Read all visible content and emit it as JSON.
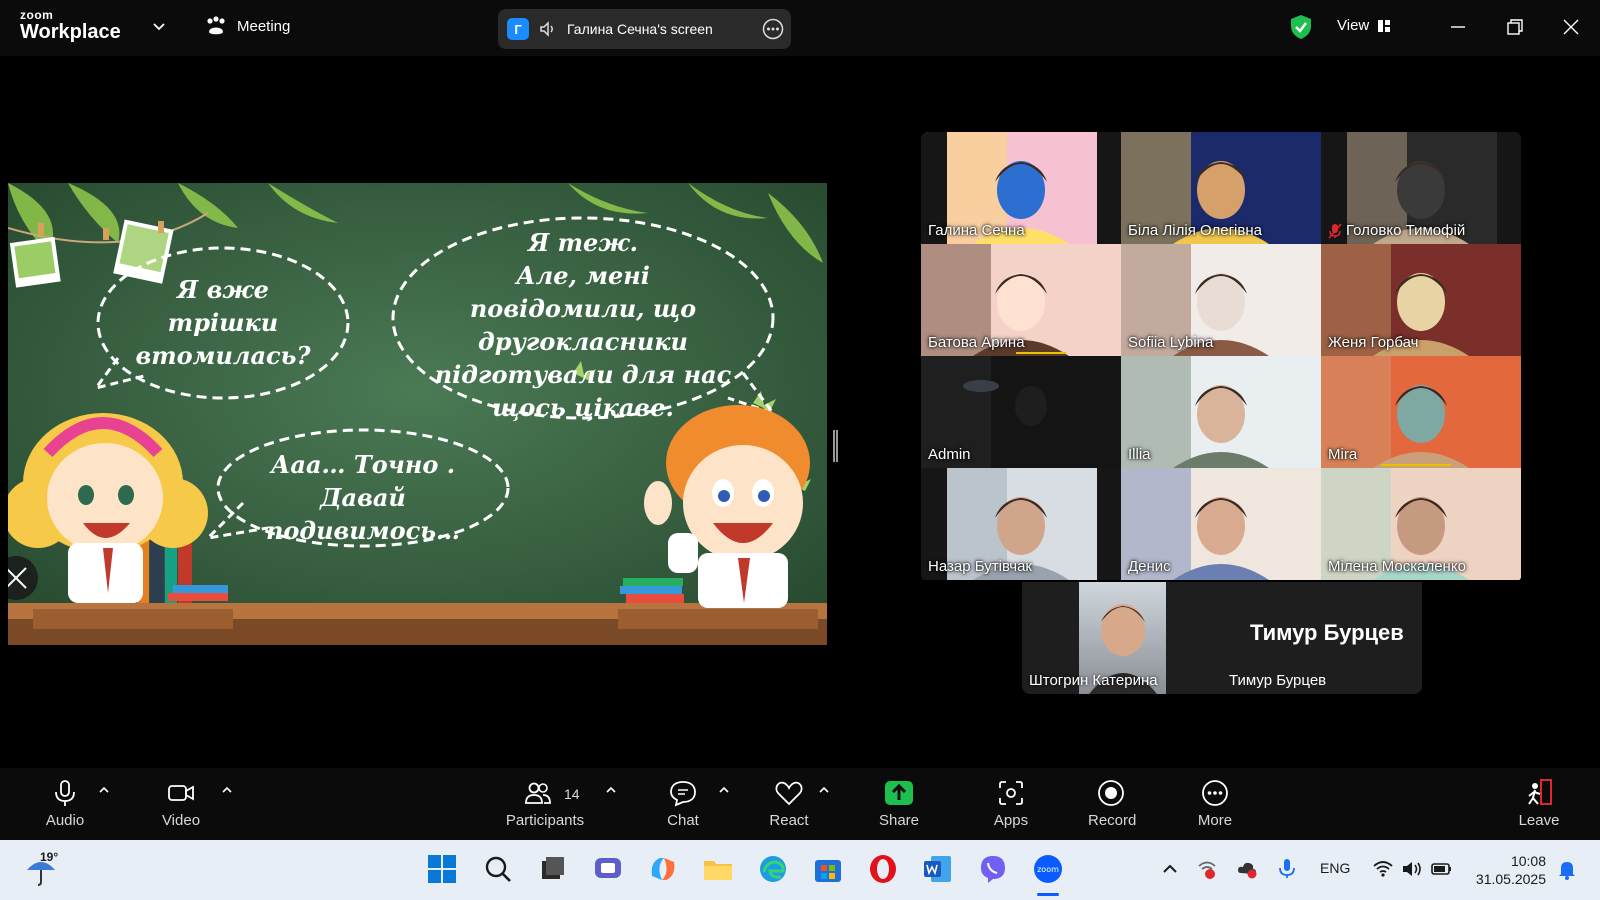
{
  "app": {
    "brand_line1": "zoom",
    "brand_line2": "Workplace",
    "meeting_label": "Meeting",
    "view_label": "View"
  },
  "share_banner": {
    "avatar_letter": "Г",
    "text": "Галина Сечна's screen"
  },
  "slide": {
    "bubble_left": [
      "Я вже",
      "трішки",
      "втомилась?"
    ],
    "bubble_right": [
      "Я теж.",
      "Але, мені",
      "повідомили, що",
      "другокласники",
      "підготували для нас",
      "щось цікаве."
    ],
    "bubble_bottom": [
      "Ааа… Точно .",
      "Давай",
      "подивимось…"
    ]
  },
  "participants": [
    {
      "name": "Галина Сечна",
      "active": true,
      "muted": false,
      "scene": "flowers"
    },
    {
      "name": "Біла Лілія Олегівна",
      "active": false,
      "muted": false,
      "scene": "balloons"
    },
    {
      "name": "Головко Тимофій",
      "active": false,
      "muted": true,
      "scene": "dark-room"
    },
    {
      "name": "Батова Арина",
      "active": false,
      "muted": false,
      "scene": "girl-pink"
    },
    {
      "name": "Sofiia Lybina",
      "active": false,
      "muted": false,
      "scene": "girl-light"
    },
    {
      "name": "Женя Горбач",
      "active": false,
      "muted": false,
      "scene": "carpet"
    },
    {
      "name": "Admin",
      "active": false,
      "muted": false,
      "scene": "dark"
    },
    {
      "name": "Illia",
      "active": false,
      "muted": false,
      "scene": "boy-glasses"
    },
    {
      "name": "Mira",
      "active": false,
      "muted": false,
      "scene": "girl-orange"
    },
    {
      "name": "Назар Бутівчак",
      "active": false,
      "muted": false,
      "scene": "boy-curtain"
    },
    {
      "name": "Денис",
      "active": false,
      "muted": false,
      "scene": "boy-shirt"
    },
    {
      "name": "Мілена Москаленко",
      "active": false,
      "muted": false,
      "scene": "girl-hand"
    }
  ],
  "last_row": {
    "left_name": "Штогрин Катерина",
    "right_big_name": "Тимур Бурцев",
    "right_name": "Тимур Бурцев"
  },
  "toolbar": {
    "audio": "Audio",
    "video": "Video",
    "participants": "Participants",
    "participants_count": "14",
    "chat": "Chat",
    "react": "React",
    "share": "Share",
    "apps": "Apps",
    "record": "Record",
    "more": "More",
    "leave": "Leave"
  },
  "taskbar": {
    "temperature": "19°",
    "language": "ENG",
    "time": "10:08",
    "date": "31.05.2025"
  },
  "colors": {
    "active_speaker": "#1ed760",
    "share_green": "#1fbf4f",
    "leave_red": "#e0262e",
    "chalkboard": "#2f5a3a"
  }
}
